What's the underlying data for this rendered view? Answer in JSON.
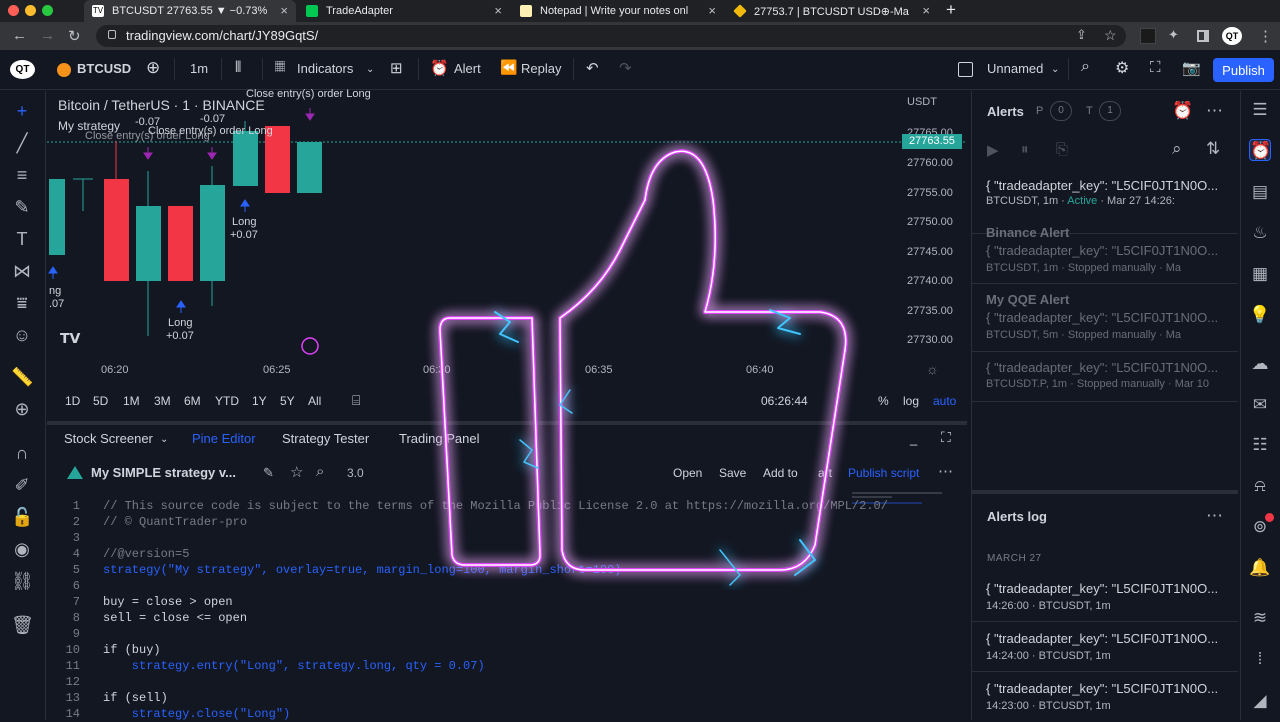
{
  "browser": {
    "tabs": [
      {
        "label": "BTCUSDT 27763.55 ▼ −0.73%",
        "color": "#5f6368"
      },
      {
        "label": "TradeAdapter",
        "color": "#00c853"
      },
      {
        "label": "Notepad | Write your notes onl",
        "color": "#fff1b5"
      },
      {
        "label": "27753.7 | BTCUSDT USD⊕-Ma",
        "color": "#f0b90b"
      }
    ],
    "url": "tradingview.com/chart/JY89GqtS/",
    "new_tab": "+"
  },
  "toolbar": {
    "logo": "QT",
    "symbol": "BTCUSD",
    "interval": "1m",
    "indicators": "Indicators",
    "alert": "Alert",
    "replay": "Replay",
    "layout_name": "Unnamed",
    "publish": "Publish"
  },
  "chart": {
    "title": "Bitcoin / TetherUS · 1 · BINANCE",
    "strategy": "My strategy",
    "currency": "USDT",
    "current_price": "27763.55",
    "price_labels": [
      "27765.00",
      "27760.00",
      "27755.00",
      "27750.00",
      "27745.00",
      "27740.00",
      "27735.00",
      "27730.00"
    ],
    "time_labels": [
      "06:20",
      "06:25",
      "06:30",
      "06:35",
      "06:40"
    ],
    "annotations": {
      "close_long_top": "Close entry(s) order Long",
      "close_long_2": "Close entry(s) order Long",
      "close_long_3": "Close entry(s) order Long",
      "neg1": "-0.07",
      "neg2": "-0.07",
      "long1": "Long",
      "pos1": "+0.07",
      "long2": "Long",
      "pos2": "+0.07",
      "ng": "ng",
      "n07": ".07"
    },
    "ranges": [
      "1D",
      "5D",
      "1M",
      "3M",
      "6M",
      "YTD",
      "1Y",
      "5Y",
      "All"
    ],
    "clock": "06:26:44",
    "percent": "%",
    "log": "log",
    "auto": "auto"
  },
  "bottom": {
    "tabs": [
      "Stock Screener",
      "Pine Editor",
      "Strategy Tester",
      "Trading Panel"
    ],
    "script_name": "My SIMPLE strategy v...",
    "version": "3.0",
    "open": "Open",
    "save": "Save",
    "add_to": "Add to",
    "chart": "art",
    "publish_script": "Publish script",
    "code": [
      "// This source code is subject to the terms of the Mozilla Public License 2.0 at https://mozilla.org/MPL/2.0/",
      "// © QuantTrader-pro",
      "",
      "//@version=5",
      "strategy(\"My strategy\", overlay=true, margin_long=100, margin_short=100)",
      "",
      "buy = close > open",
      "sell = close <= open",
      "",
      "if (buy)",
      "    strategy.entry(\"Long\", strategy.long, qty = 0.07)",
      "",
      "if (sell)",
      "    strategy.close(\"Long\")"
    ],
    "line_numbers": [
      "1",
      "2",
      "3",
      "4",
      "5",
      "6",
      "7",
      "8",
      "9",
      "10",
      "11",
      "12",
      "13",
      "14"
    ]
  },
  "alerts": {
    "title": "Alerts",
    "p_label": "P",
    "p_count": "0",
    "t_label": "T",
    "t_count": "1",
    "items": [
      {
        "title": "{ \"tradeadapter_key\": \"L5CIF0JT1N0O...",
        "sym": "BTCUSDT, 1m",
        "status": "Active",
        "date": "Mar 27 14:26:"
      },
      {
        "title": "Binance Alert",
        "sub": "{ \"tradeadapter_key\": \"L5CIF0JT1N0O...",
        "sym": "BTCUSDT, 1m",
        "status": "Stopped manually",
        "date": "Ma"
      },
      {
        "title": "My QQE Alert",
        "sub": "{ \"tradeadapter_key\": \"L5CIF0JT1N0O...",
        "sym": "BTCUSDT, 5m",
        "status": "Stopped manually",
        "date": "Ma"
      },
      {
        "title": "{ \"tradeadapter_key\": \"L5CIF0JT1N0O...",
        "sym": "BTCUSDT.P, 1m",
        "status": "Stopped manually",
        "date": "Mar 10"
      }
    ],
    "log_title": "Alerts log",
    "log_date": "MARCH 27",
    "log": [
      {
        "title": "{ \"tradeadapter_key\": \"L5CIF0JT1N0O...",
        "meta": "14:26:00 · BTCUSDT, 1m"
      },
      {
        "title": "{ \"tradeadapter_key\": \"L5CIF0JT1N0O...",
        "meta": "14:24:00 · BTCUSDT, 1m"
      },
      {
        "title": "{ \"tradeadapter_key\": \"L5CIF0JT1N0O...",
        "meta": "14:23:00 · BTCUSDT, 1m"
      }
    ]
  },
  "colors": {
    "accent": "#2962ff",
    "up": "#26a69a",
    "down": "#f23645",
    "glow": "#e040fb"
  }
}
